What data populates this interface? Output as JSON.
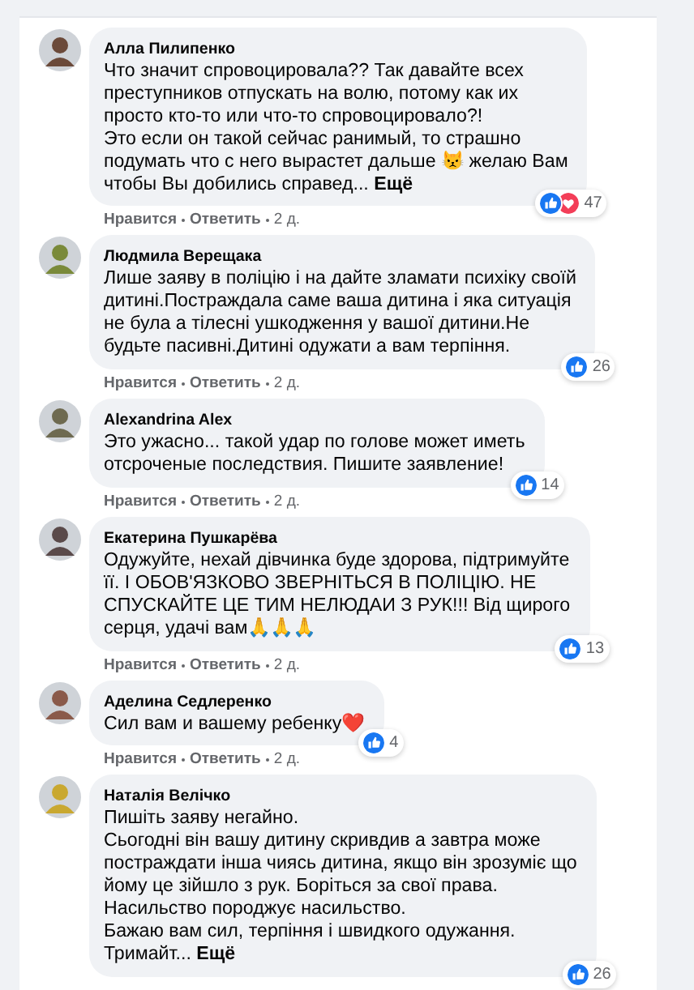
{
  "comments": [
    {
      "author": "Алла Пилипенко",
      "text": "Что значит спровоцировала?? Так давайте всех\nпреступников отпускать на волю, потому как их\nпросто кто-то или что-то спровоцировало?!\nЭто если он такой сейчас ранимый, то страшно\nподумать что с него вырастет дальше 😾 желаю Вам\nчтобы Вы добились справед... ",
      "more": "Ещё",
      "reactions": [
        {
          "kind": "like"
        },
        {
          "kind": "love"
        }
      ],
      "count": "47",
      "actions": [
        "Нравится",
        "Ответить",
        "2 д."
      ]
    },
    {
      "author": "Людмила Верещака",
      "text": "Лише заяву в поліцію і на дайте зламати психіку своїй\nдитині.Постраждала саме ваша дитина і яка ситуація\nне була а тілесні ушкодження у вашої дитини.Не\nбудьте пасивні.Дитині одужати а вам терпіння.",
      "reactions": [
        {
          "kind": "like"
        }
      ],
      "count": "26",
      "actions": [
        "Нравится",
        "Ответить",
        "2 д."
      ]
    },
    {
      "author": "Alexandrina Alex",
      "text": "Это ужасно... такой удар по голове может иметь\nотсроченые последствия. Пишите заявление!",
      "reactions": [
        {
          "kind": "like"
        }
      ],
      "count": "14",
      "actions": [
        "Нравится",
        "Ответить",
        "2 д."
      ]
    },
    {
      "author": "Екатерина Пушкарёва",
      "text": "Одужуйте, нехай дівчинка буде здорова, підтримуйте\nїї. І ОБОВ'ЯЗКОВО ЗВЕРНІТЬСЯ В ПОЛІЦІЮ. НЕ\nСПУСКАЙТЕ ЦЕ ТИМ НЕЛЮДАИ З РУК!!! Від щирого\nсерця, удачі вам🙏🙏🙏",
      "reactions": [
        {
          "kind": "like"
        }
      ],
      "count": "13",
      "actions": [
        "Нравится",
        "Ответить",
        "2 д."
      ]
    },
    {
      "author": "Аделина Седлеренко",
      "text": "Сил вам и вашему ребенку❤️",
      "reactions": [
        {
          "kind": "like"
        }
      ],
      "count": "4",
      "actions": [
        "Нравится",
        "Ответить",
        "2 д."
      ]
    },
    {
      "author": "Наталія Велічко",
      "text": "Пишіть заяву негайно.\nСьогодні він вашу дитину скривдив а завтра може\nпостраждати інша чиясь дитина, якщо він зрозуміє що\nйому це зійшло з рук. Боріться за свої права.\nНасильство породжує насильство.\nБажаю вам сил, терпіння і швидкого одужання.\nТримайт... ",
      "more": "Ещё",
      "reactions": [
        {
          "kind": "like"
        }
      ],
      "count": "26"
    }
  ]
}
